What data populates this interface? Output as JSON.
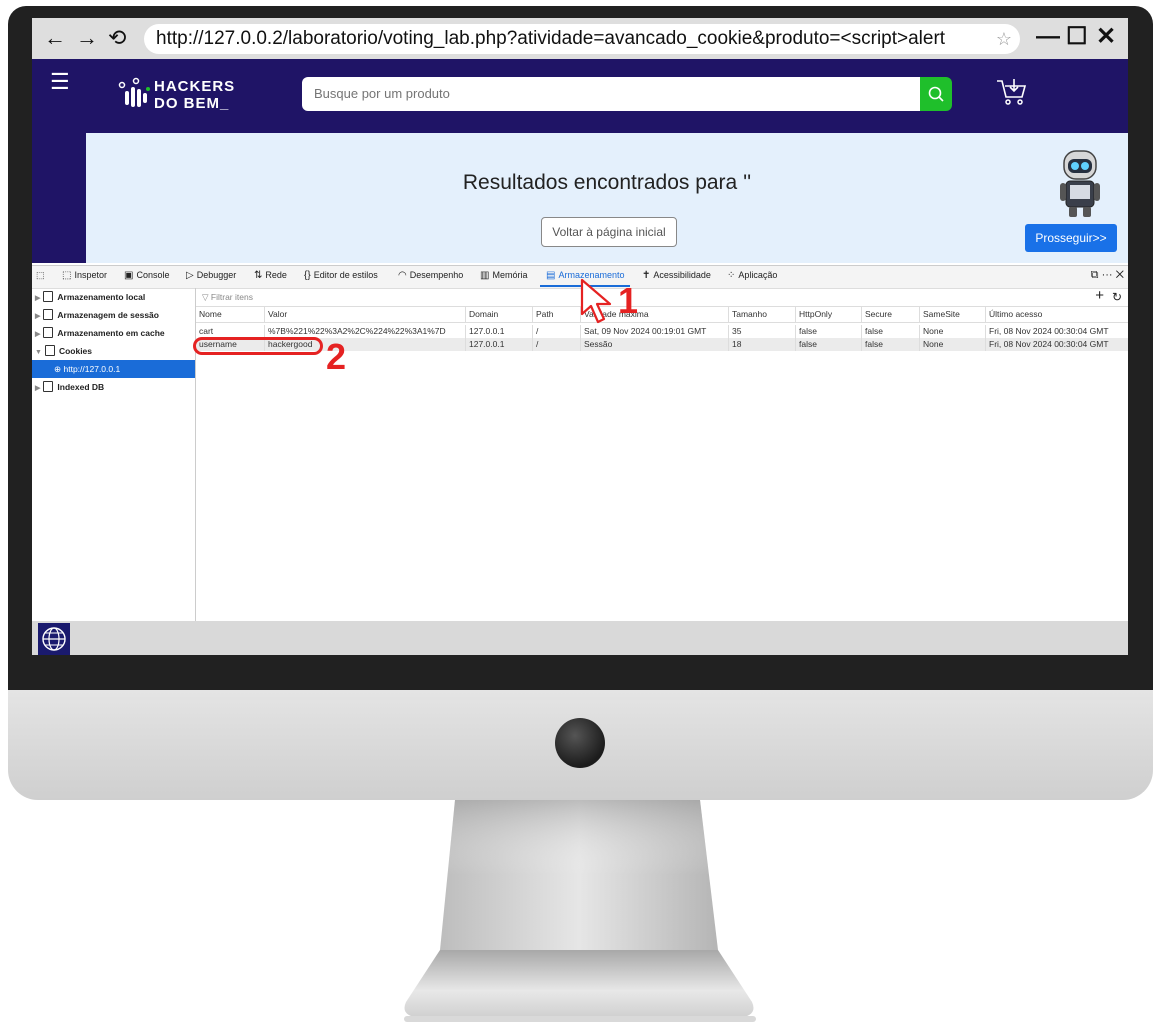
{
  "browser": {
    "url": "http://127.0.0.2/laboratorio/voting_lab.php?atividade=avancado_cookie&produto=<script>alert",
    "back": "←",
    "forward": "→",
    "reload": "⟲",
    "star": "☆",
    "minimize": "—",
    "maximize": "☐",
    "close": "✕"
  },
  "site": {
    "logo_line1": "HACKERS",
    "logo_line2": "DO BEM_",
    "search_placeholder": "Busque por um produto",
    "results_title": "Resultados encontrados para ''",
    "back_button": "Voltar à página inicial",
    "proceed_button": "Prosseguir>>"
  },
  "devtools": {
    "tabs": [
      "Inspetor",
      "Console",
      "Debugger",
      "Rede",
      "Editor de estilos",
      "Desempenho",
      "Memória",
      "Armazenamento",
      "Acessibilidade",
      "Aplicação"
    ],
    "active_tab": "Armazenamento",
    "sidebar": [
      "Armazenamento local",
      "Armazenagem de sessão",
      "Armazenamento em cache",
      "Cookies",
      "http://127.0.0.1",
      "Indexed DB"
    ],
    "filter_placeholder": "Filtrar itens",
    "columns": [
      "Nome",
      "Valor",
      "Domain",
      "Path",
      "Validade máxima",
      "Tamanho",
      "HttpOnly",
      "Secure",
      "SameSite",
      "Último acesso"
    ],
    "rows": [
      [
        "cart",
        "%7B%221%22%3A2%2C%224%22%3A1%7D",
        "127.0.0.1",
        "/",
        "Sat, 09 Nov 2024 00:19:01 GMT",
        "35",
        "false",
        "false",
        "None",
        "Fri, 08 Nov 2024 00:30:04 GMT"
      ],
      [
        "username",
        "hackergood",
        "127.0.0.1",
        "/",
        "Sessão",
        "18",
        "false",
        "false",
        "None",
        "Fri, 08 Nov 2024 00:30:04 GMT"
      ]
    ]
  },
  "annotations": {
    "step1": "1",
    "step2": "2"
  },
  "colors": {
    "site_header": "#1f1466",
    "accent": "#1a6cd8",
    "search_button": "#1fbf2b",
    "annotation": "#e52222"
  }
}
